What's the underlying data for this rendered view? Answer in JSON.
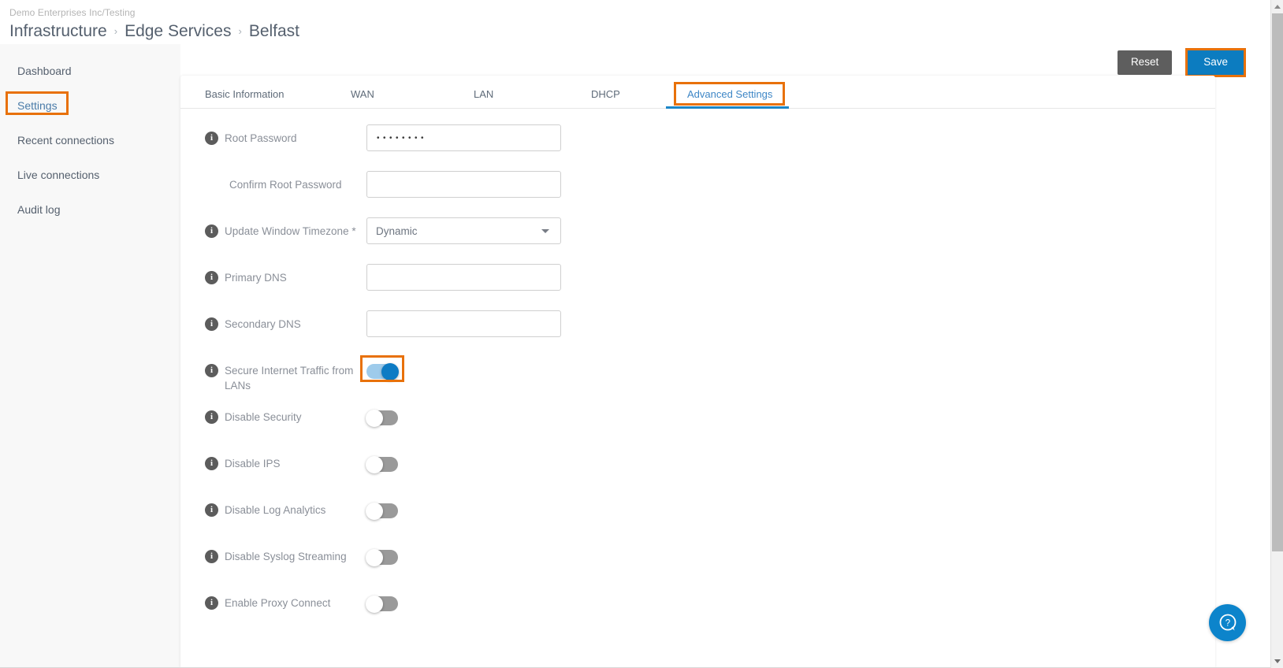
{
  "header": {
    "org": "Demo Enterprises Inc/Testing",
    "breadcrumb": [
      "Infrastructure",
      "Edge Services",
      "Belfast"
    ],
    "separator": "›"
  },
  "actions": {
    "reset_label": "Reset",
    "save_label": "Save"
  },
  "sidebar": {
    "items": [
      {
        "label": "Dashboard",
        "active": false
      },
      {
        "label": "Settings",
        "active": true
      },
      {
        "label": "Recent connections",
        "active": false
      },
      {
        "label": "Live connections",
        "active": false
      },
      {
        "label": "Audit log",
        "active": false
      }
    ]
  },
  "tabs": [
    {
      "label": "Basic Information",
      "active": false
    },
    {
      "label": "WAN",
      "active": false
    },
    {
      "label": "LAN",
      "active": false
    },
    {
      "label": "DHCP",
      "active": false
    },
    {
      "label": "Advanced Settings",
      "active": true
    }
  ],
  "form": {
    "rows": [
      {
        "label": "Root Password",
        "info": true,
        "type": "password",
        "value": "••••••••",
        "placeholder": ""
      },
      {
        "label": "Confirm Root Password",
        "info": false,
        "type": "text",
        "value": "",
        "placeholder": ""
      },
      {
        "label": "Update Window Timezone *",
        "info": true,
        "type": "select",
        "value": "Dynamic",
        "placeholder": ""
      },
      {
        "label": "Primary DNS",
        "info": true,
        "type": "text",
        "value": "",
        "placeholder": ""
      },
      {
        "label": "Secondary DNS",
        "info": true,
        "type": "text",
        "value": "",
        "placeholder": ""
      },
      {
        "label": "Secure Internet Traffic from LANs",
        "info": true,
        "type": "toggle",
        "value": "on",
        "highlighted": true
      },
      {
        "label": "Disable Security",
        "info": true,
        "type": "toggle",
        "value": "off",
        "highlighted": false
      },
      {
        "label": "Disable IPS",
        "info": true,
        "type": "toggle",
        "value": "off",
        "highlighted": false
      },
      {
        "label": "Disable Log Analytics",
        "info": true,
        "type": "toggle",
        "value": "off",
        "highlighted": false
      },
      {
        "label": "Disable Syslog Streaming",
        "info": true,
        "type": "toggle",
        "value": "off",
        "highlighted": false
      },
      {
        "label": "Enable Proxy Connect",
        "info": true,
        "type": "toggle",
        "value": "off",
        "highlighted": false
      }
    ],
    "info_glyph": "i"
  },
  "help": {
    "icon": "help-question-bubble-icon"
  },
  "colors": {
    "accent_blue": "#0c7cc0",
    "highlight_orange": "#e8710a",
    "toggle_on_track": "#9ecbeb",
    "toggle_on_knob": "#0d7bc4",
    "toggle_off_track": "#9a9a9a",
    "sidebar_bg": "#f8f8f8",
    "label_gray": "#8a8f98"
  }
}
